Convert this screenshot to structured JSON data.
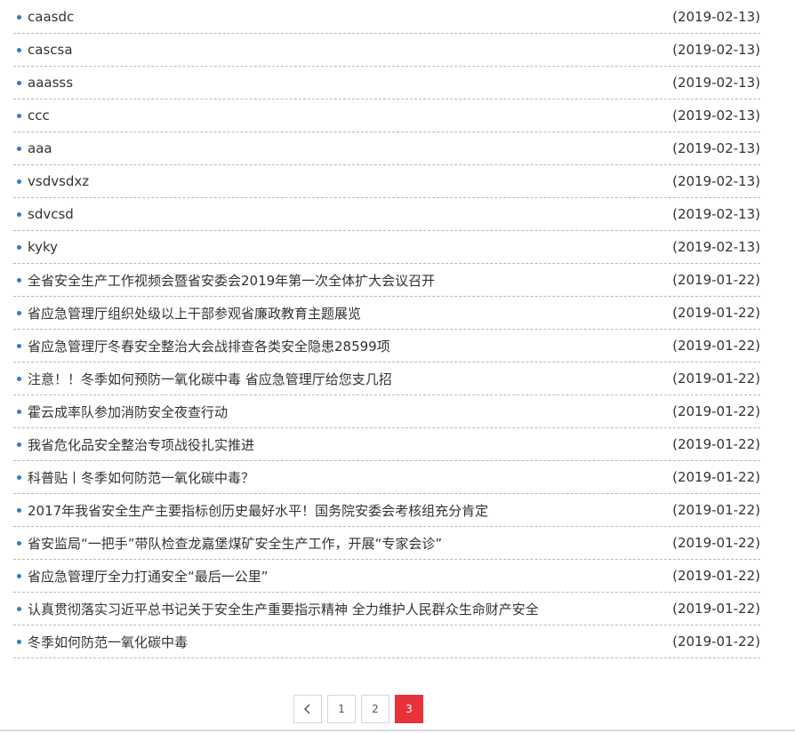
{
  "articles": [
    {
      "title": "caasdc",
      "date": "(2019-02-13)"
    },
    {
      "title": "cascsa",
      "date": "(2019-02-13)"
    },
    {
      "title": "aaasss",
      "date": "(2019-02-13)"
    },
    {
      "title": "ccc",
      "date": "(2019-02-13)"
    },
    {
      "title": "aaa",
      "date": "(2019-02-13)"
    },
    {
      "title": "vsdvsdxz",
      "date": "(2019-02-13)"
    },
    {
      "title": "sdvcsd",
      "date": "(2019-02-13)"
    },
    {
      "title": "kyky",
      "date": "(2019-02-13)"
    },
    {
      "title": "全省安全生产工作视频会暨省安委会2019年第一次全体扩大会议召开",
      "date": "(2019-01-22)"
    },
    {
      "title": "省应急管理厅组织处级以上干部参观省廉政教育主题展览",
      "date": "(2019-01-22)"
    },
    {
      "title": "省应急管理厅冬春安全整治大会战排查各类安全隐患28599项",
      "date": "(2019-01-22)"
    },
    {
      "title": "注意！！冬季如何预防一氧化碳中毒 省应急管理厅给您支几招",
      "date": "(2019-01-22)"
    },
    {
      "title": "霍云成率队参加消防安全夜查行动",
      "date": "(2019-01-22)"
    },
    {
      "title": "我省危化品安全整治专项战役扎实推进",
      "date": "(2019-01-22)"
    },
    {
      "title": "科普贴丨冬季如何防范一氧化碳中毒？",
      "date": "(2019-01-22)"
    },
    {
      "title": "2017年我省安全生产主要指标创历史最好水平！国务院安委会考核组充分肯定",
      "date": "(2019-01-22)"
    },
    {
      "title": "省安监局“一把手”带队检查龙嘉堡煤矿安全生产工作，开展“专家会诊”",
      "date": "(2019-01-22)"
    },
    {
      "title": "省应急管理厅全力打通安全“最后一公里”",
      "date": "(2019-01-22)"
    },
    {
      "title": "认真贯彻落实习近平总书记关于安全生产重要指示精神 全力维护人民群众生命财产安全",
      "date": "(2019-01-22)"
    },
    {
      "title": "冬季如何防范一氧化碳中毒",
      "date": "(2019-01-22)"
    }
  ],
  "pagination": {
    "prev_icon": "chevron-left-icon",
    "pages": [
      "1",
      "2",
      "3"
    ],
    "current": "3"
  },
  "colors": {
    "bullet": "#2a7fc9",
    "active_page": "#e8323a",
    "divider": "#b8b8b8"
  }
}
